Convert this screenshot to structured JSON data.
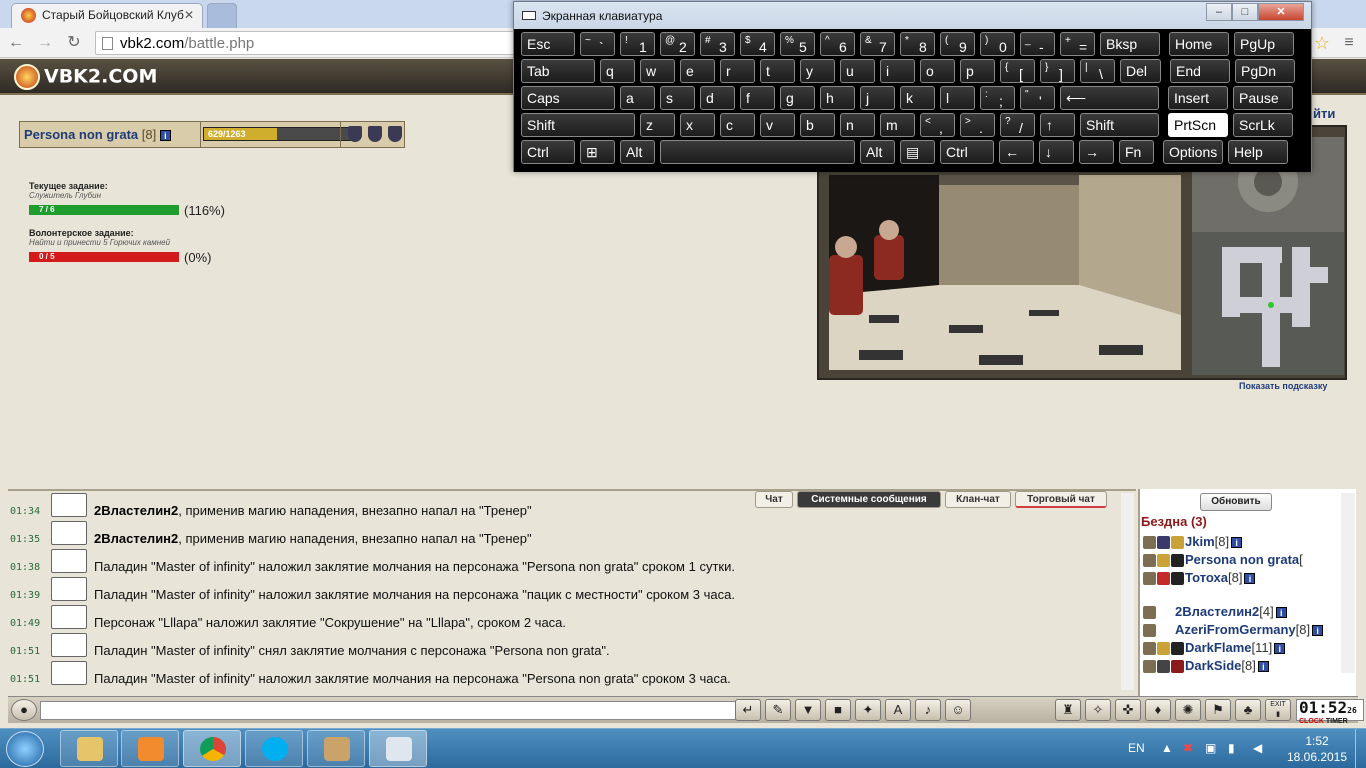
{
  "browser": {
    "tab_title": "Старый Бойцовский Клуб",
    "url_host": "vbk2.com",
    "url_path": "/battle.php"
  },
  "site": {
    "logo_text": "VBK2.COM",
    "exit_link": "йти"
  },
  "character": {
    "name": "Persona non grata",
    "level": "[8]",
    "hp_text": "629/1263",
    "hp_fraction": 0.5
  },
  "quests": {
    "current_title": "Текущее задание:",
    "current_name": "Служитель Глубин",
    "current_progress": "7 / 6",
    "current_percent": "(116%)",
    "current_fill": 1.0,
    "volunteer_title": "Волонтерское задание:",
    "volunteer_name": "Найти и принести 5 Горючих камней",
    "volunteer_progress": "0 / 5",
    "volunteer_percent": "(0%)",
    "volunteer_fill": 0.0
  },
  "game": {
    "hint_link": "Показать подсказку"
  },
  "osk": {
    "title": "Экранная клавиатура",
    "rows": [
      [
        {
          "l": "Esc"
        },
        {
          "u": "~",
          "d": "`"
        },
        {
          "u": "!",
          "d": "1"
        },
        {
          "u": "@",
          "d": "2"
        },
        {
          "u": "#",
          "d": "3"
        },
        {
          "u": "$",
          "d": "4"
        },
        {
          "u": "%",
          "d": "5"
        },
        {
          "u": "^",
          "d": "6"
        },
        {
          "u": "&",
          "d": "7"
        },
        {
          "u": "*",
          "d": "8"
        },
        {
          "u": "(",
          "d": "9"
        },
        {
          "u": ")",
          "d": "0"
        },
        {
          "u": "_",
          "d": "-"
        },
        {
          "u": "+",
          "d": "="
        },
        {
          "l": "Bksp"
        },
        {
          "l": "Home"
        },
        {
          "l": "PgUp"
        }
      ],
      [
        {
          "l": "Tab"
        },
        {
          "l": "q"
        },
        {
          "l": "w"
        },
        {
          "l": "e"
        },
        {
          "l": "r"
        },
        {
          "l": "t"
        },
        {
          "l": "y"
        },
        {
          "l": "u"
        },
        {
          "l": "i"
        },
        {
          "l": "o"
        },
        {
          "l": "p"
        },
        {
          "u": "{",
          "d": "["
        },
        {
          "u": "}",
          "d": "]"
        },
        {
          "u": "|",
          "d": "\\"
        },
        {
          "l": "Del"
        },
        {
          "l": "End"
        },
        {
          "l": "PgDn"
        }
      ],
      [
        {
          "l": "Caps"
        },
        {
          "l": "a"
        },
        {
          "l": "s"
        },
        {
          "l": "d"
        },
        {
          "l": "f"
        },
        {
          "l": "g"
        },
        {
          "l": "h"
        },
        {
          "l": "j"
        },
        {
          "l": "k"
        },
        {
          "l": "l"
        },
        {
          "u": ":",
          "d": ";"
        },
        {
          "u": "\"",
          "d": "'"
        },
        {
          "l": "⟵"
        },
        {
          "l": "Insert"
        },
        {
          "l": "Pause"
        }
      ],
      [
        {
          "l": "Shift"
        },
        {
          "l": "z"
        },
        {
          "l": "x"
        },
        {
          "l": "c"
        },
        {
          "l": "v"
        },
        {
          "l": "b"
        },
        {
          "l": "n"
        },
        {
          "l": "m"
        },
        {
          "u": "<",
          "d": ","
        },
        {
          "u": ">",
          "d": "."
        },
        {
          "u": "?",
          "d": "/"
        },
        {
          "l": "↑"
        },
        {
          "l": "Shift"
        },
        {
          "l": "PrtScn"
        },
        {
          "l": "ScrLk"
        }
      ],
      [
        {
          "l": "Ctrl"
        },
        {
          "l": "⊞"
        },
        {
          "l": "Alt"
        },
        {
          "l": ""
        },
        {
          "l": "Alt"
        },
        {
          "l": "▤"
        },
        {
          "l": "Ctrl"
        },
        {
          "l": "←"
        },
        {
          "l": "↓"
        },
        {
          "l": "→"
        },
        {
          "l": "Fn"
        },
        {
          "l": "Options"
        },
        {
          "l": "Help"
        }
      ]
    ]
  },
  "chat": {
    "tabs": [
      "Чат",
      "Системные сообщения",
      "Клан-чат",
      "Торговый чат"
    ],
    "messages": [
      {
        "time": "01:34",
        "actor": "2Властелин2",
        "text": ", применив магию нападения, внезапно напал на \"Тренер\""
      },
      {
        "time": "01:35",
        "actor": "2Властелин2",
        "text": ", применив магию нападения, внезапно напал на \"Тренер\""
      },
      {
        "time": "01:38",
        "actor": "",
        "text": "Паладин \"Master of infinity\" наложил заклятие молчания на персонажа \"Persona non grata\" сроком 1 сутки."
      },
      {
        "time": "01:39",
        "actor": "",
        "text": "Паладин \"Master of infinity\" наложил заклятие молчания на персонажа \"пацик с местности\" сроком 3 часа."
      },
      {
        "time": "01:49",
        "actor": "",
        "text": "Персонаж \"Lllapa\" наложил заклятие \"Сокрушение\" на \"Lllapa\", сроком 2 часа."
      },
      {
        "time": "01:51",
        "actor": "",
        "text": "Паладин \"Master of infinity\" снял заклятие молчания с персонажа \"Persona non grata\"."
      },
      {
        "time": "01:51",
        "actor": "",
        "text": "Паладин \"Master of infinity\" наложил заклятие молчания на персонажа \"Persona non grata\" сроком 3 часа."
      }
    ]
  },
  "online": {
    "refresh_label": "Обновить",
    "room": "Бездна (3)",
    "players": [
      {
        "name": "Jkim",
        "level": "[8]"
      },
      {
        "name": "Persona non grata",
        "level": "["
      },
      {
        "name": "Тотоха",
        "level": "[8]"
      },
      {
        "name": "2Властелин2",
        "level": "[4]"
      },
      {
        "name": "AzeriFromGermany",
        "level": "[8]"
      },
      {
        "name": "DarkFlame",
        "level": "[11]"
      },
      {
        "name": "DarkSide",
        "level": "[8]"
      }
    ]
  },
  "clock_widget": {
    "time": "01:52",
    "seconds": "26",
    "label_clock": "CLOCK",
    "label_timer": "TIMER",
    "exit_label": "EXIT"
  },
  "taskbar": {
    "lang": "EN",
    "time": "1:52",
    "date": "18.06.2015"
  }
}
